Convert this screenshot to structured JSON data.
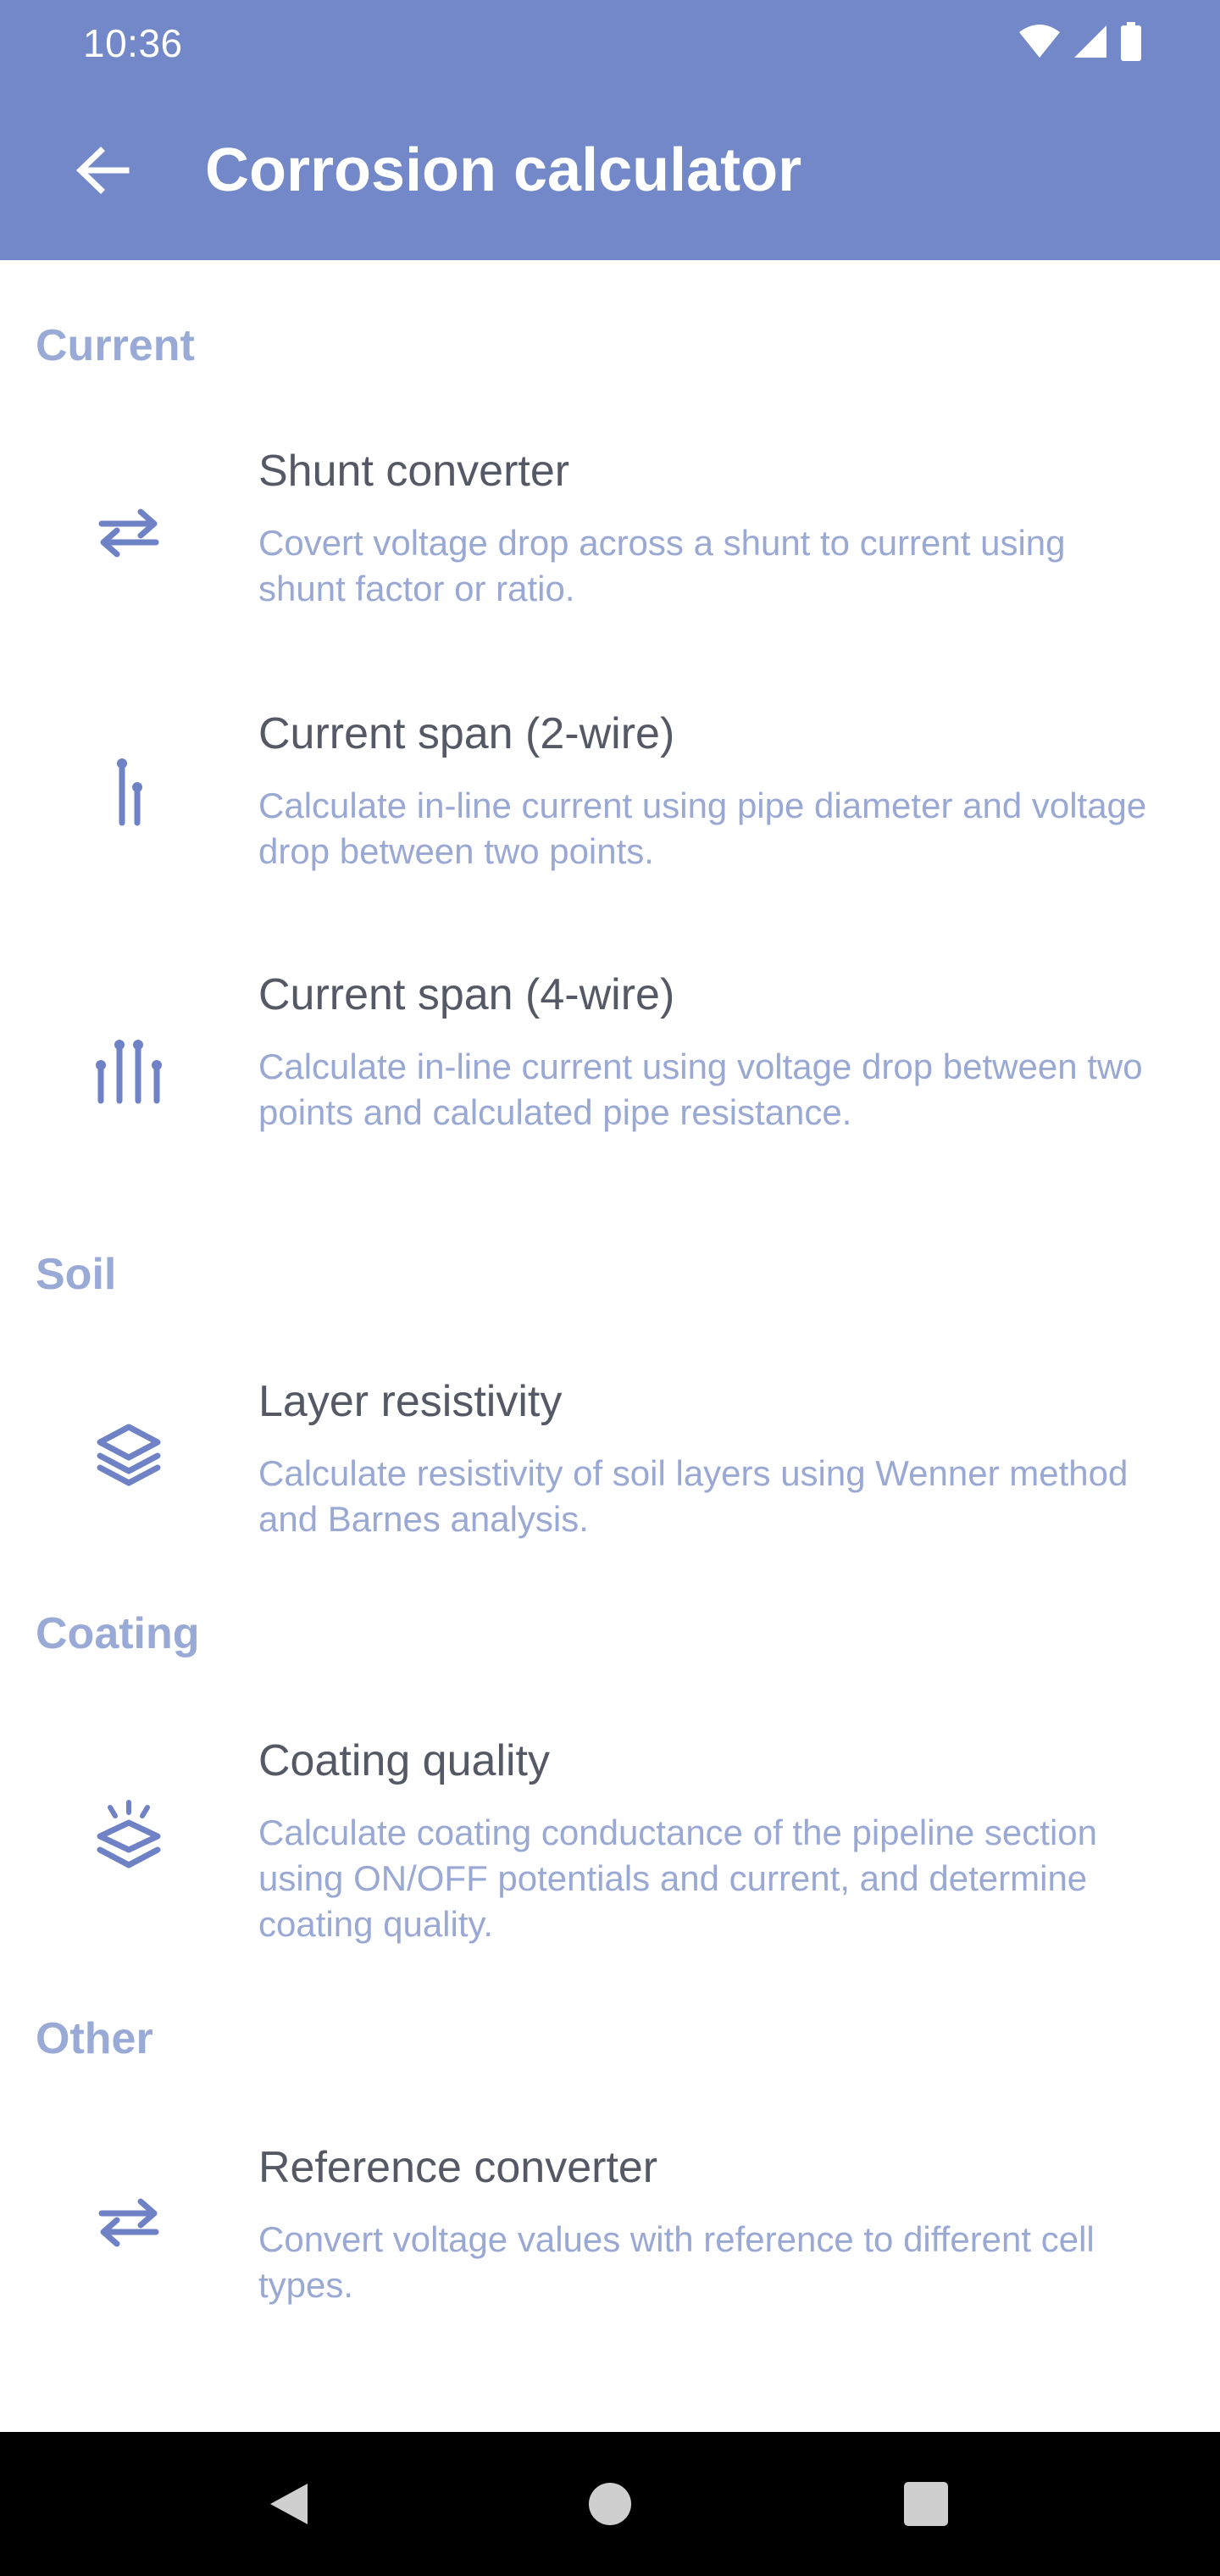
{
  "status_bar": {
    "time": "10:36"
  },
  "app_bar": {
    "title": "Corrosion calculator",
    "back_icon": "arrow-left-icon"
  },
  "colors": {
    "primary": "#7388c8",
    "section_header": "#9aaad6",
    "title_text": "#545965",
    "description_text": "#9aa8d4",
    "icon": "#6f82c6"
  },
  "sections": [
    {
      "label": "Current",
      "items": [
        {
          "title": "Shunt converter",
          "description": "Covert voltage drop across a shunt to current using shunt factor or ratio.",
          "icon": "swap-arrows-icon"
        },
        {
          "title": "Current span (2-wire)",
          "description": "Calculate in-line current using pipe diameter and voltage drop between two points.",
          "icon": "two-wire-icon"
        },
        {
          "title": "Current span (4-wire)",
          "description": "Calculate in-line current using voltage drop between two points and calculated pipe resistance.",
          "icon": "four-wire-icon"
        }
      ]
    },
    {
      "label": "Soil",
      "items": [
        {
          "title": "Layer resistivity",
          "description": "Calculate resistivity of soil layers using Wenner method and Barnes analysis.",
          "icon": "layers-icon"
        }
      ]
    },
    {
      "label": "Coating",
      "items": [
        {
          "title": "Coating quality",
          "description": "Calculate coating conductance of the pipeline section using ON/OFF potentials and current, and determine coating quality.",
          "icon": "coating-layers-icon"
        }
      ]
    },
    {
      "label": "Other",
      "items": [
        {
          "title": "Reference converter",
          "description": "Convert voltage values with reference to different cell types.",
          "icon": "swap-arrows-icon"
        }
      ]
    }
  ],
  "nav_bar": {
    "back": "nav-back-icon",
    "home": "nav-home-icon",
    "recents": "nav-recents-icon"
  }
}
